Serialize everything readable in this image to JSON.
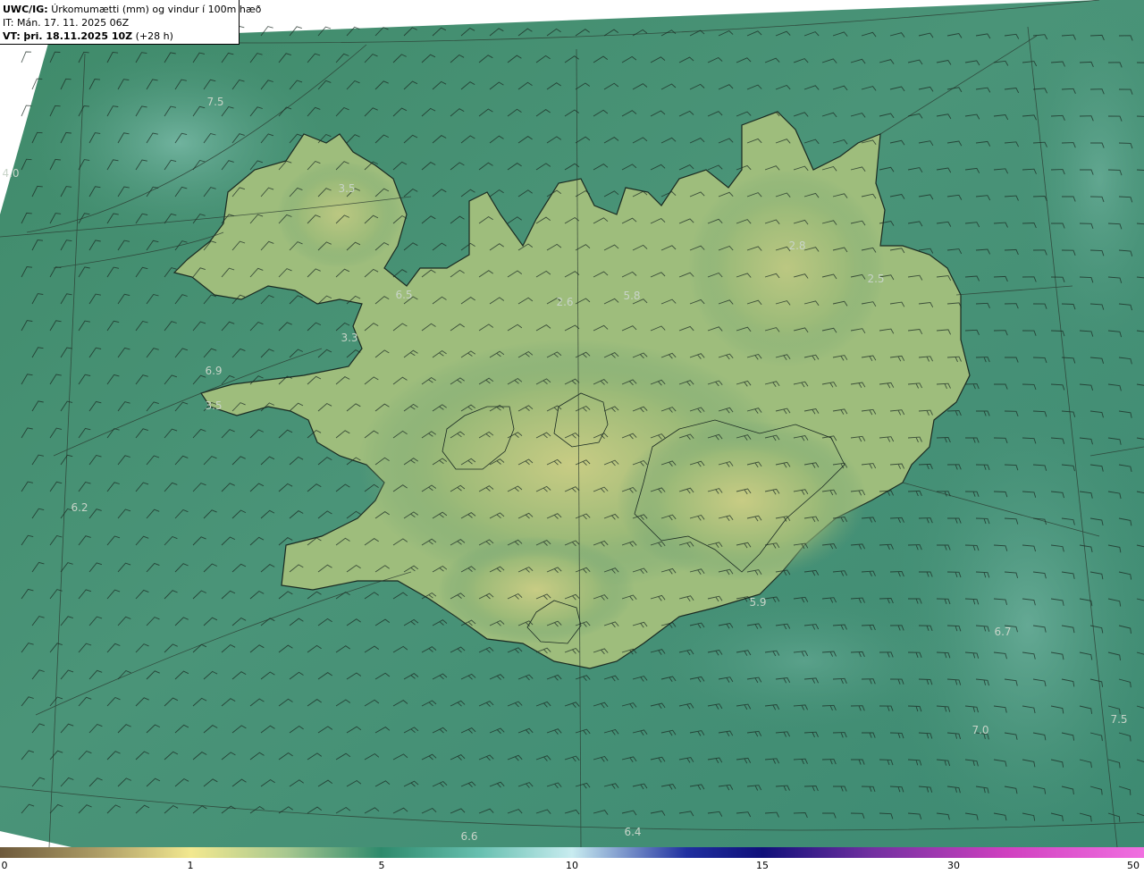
{
  "header": {
    "model": "UWC/IG:",
    "field": "Úrkomumætti (mm) og vindur í 100m hæð",
    "issue": "IT: Mán. 17. 11. 2025 06Z",
    "valid_prefix": "VT:",
    "valid_time": "þri. 18.11.2025 10Z",
    "lead": "(+28 h)"
  },
  "map": {
    "region": "Iceland",
    "field_values": [
      "7.5",
      "4.0",
      "3.5",
      "6.5",
      "3.3",
      "6.9",
      "3.5",
      "2.6",
      "5.8",
      "2.8",
      "2.5",
      "6.2",
      "5.9",
      "6.7",
      "7.0",
      "7.5",
      "6.6",
      "6.4"
    ],
    "wind_barb_icon": "wind-barb-icon"
  },
  "colorbar": {
    "ticks": [
      "0",
      "1",
      "5",
      "10",
      "15",
      "30",
      "50"
    ],
    "colors": [
      "#6e5a3c",
      "#c0b070",
      "#f2e890",
      "#a8c890",
      "#2e8a6c",
      "#68c0b0",
      "#c8ecf0",
      "#2030a0",
      "#10107a",
      "#7030a0",
      "#d040c0",
      "#f070e0"
    ]
  }
}
